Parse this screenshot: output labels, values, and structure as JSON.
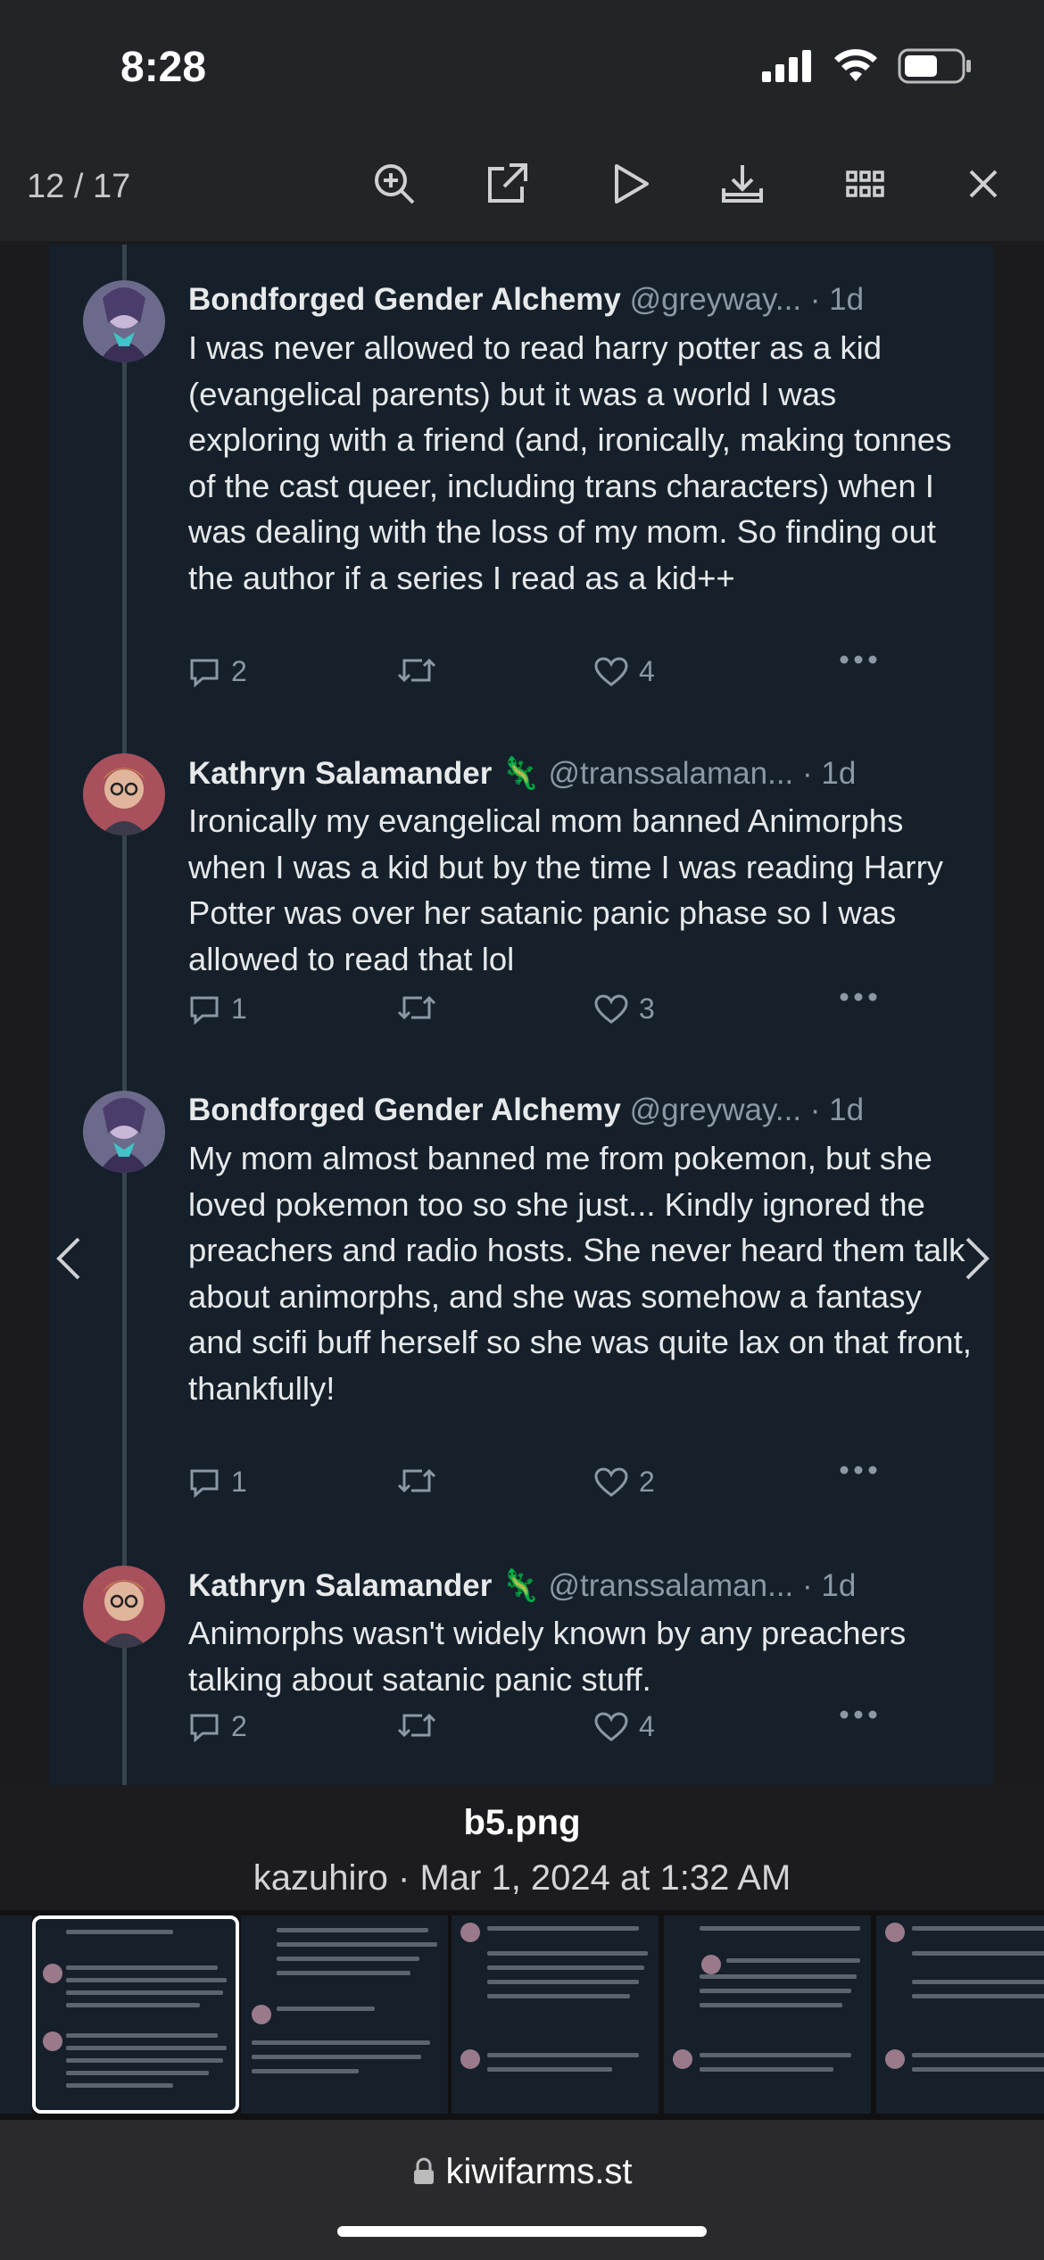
{
  "status_bar": {
    "time": "8:28"
  },
  "toolbar": {
    "counter": "12 / 17",
    "tools": [
      "zoom-in-icon",
      "external-link-icon",
      "play-icon",
      "download-icon",
      "grid-icon",
      "close-icon"
    ]
  },
  "tweets": [
    {
      "name": "Bondforged Gender Alchemy",
      "emoji": "",
      "handle": "@greyway...",
      "time": "· 1d",
      "text": "I was never allowed to read harry potter as a kid (evangelical parents) but it was a world I was exploring with a friend (and, ironically, making tonnes of the cast queer, including trans characters) when I was dealing with the loss of my mom. So finding out the author if a series I read as a kid++",
      "replies": "2",
      "retweets": "",
      "likes": "4"
    },
    {
      "name": "Kathryn Salamander",
      "emoji": "🦎",
      "handle": "@transsalaman...",
      "time": "· 1d",
      "text": "Ironically my evangelical mom banned Animorphs when I was a kid but by the time I was reading Harry Potter was over her satanic panic phase so I was allowed to read that lol",
      "replies": "1",
      "retweets": "",
      "likes": "3"
    },
    {
      "name": "Bondforged Gender Alchemy",
      "emoji": "",
      "handle": "@greyway...",
      "time": "· 1d",
      "text": "My mom almost banned me from pokemon, but she loved pokemon too so she just... Kindly ignored the preachers and radio hosts. She never heard them talk about animorphs, and she was somehow a fantasy and scifi buff herself so she was quite lax on that front, thankfully!",
      "replies": "1",
      "retweets": "",
      "likes": "2"
    },
    {
      "name": "Kathryn Salamander",
      "emoji": "🦎",
      "handle": "@transsalaman...",
      "time": "· 1d",
      "text": "Animorphs wasn't widely known by any preachers talking about satanic panic stuff.",
      "replies": "2",
      "retweets": "",
      "likes": "4"
    }
  ],
  "caption": {
    "filename": "b5.png",
    "meta": "kazuhiro · Mar 1, 2024 at 1:32 AM"
  },
  "address_bar": {
    "url": "kiwifarms.st"
  }
}
